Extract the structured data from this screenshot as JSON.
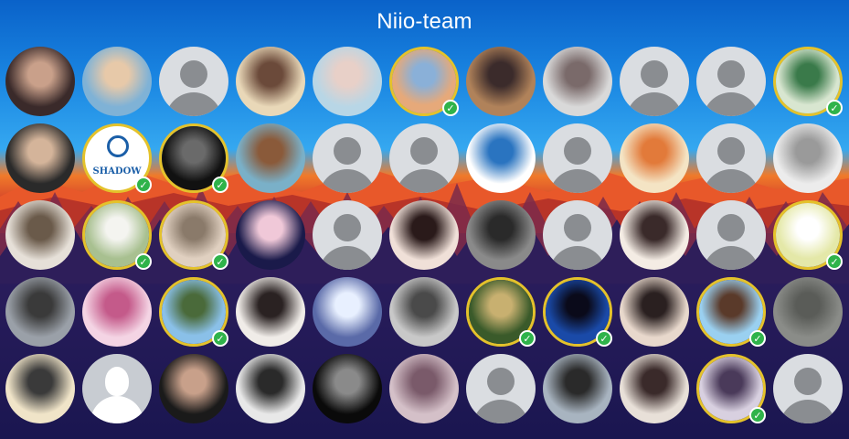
{
  "title": "Niio-team",
  "colors": {
    "badge": "#2fb34a",
    "ring": "#e4c22b",
    "placeholder_bg": "#dadde1",
    "placeholder_fg": "#8a8d91"
  },
  "avatars": [
    {
      "kind": "photo",
      "tone": [
        "#3a2a2a",
        "#c9a08a"
      ],
      "gold": false,
      "badge": false
    },
    {
      "kind": "photo",
      "tone": [
        "#7fb2d6",
        "#e7c9a9"
      ],
      "gold": false,
      "badge": false
    },
    {
      "kind": "default",
      "gold": false,
      "badge": false
    },
    {
      "kind": "photo",
      "tone": [
        "#e9d8b8",
        "#6b4a3a"
      ],
      "gold": false,
      "badge": false
    },
    {
      "kind": "photo",
      "tone": [
        "#b8d6e6",
        "#e8d0c8"
      ],
      "gold": false,
      "badge": false
    },
    {
      "kind": "photo",
      "tone": [
        "#e6a97a",
        "#8ab0d8"
      ],
      "gold": true,
      "badge": true
    },
    {
      "kind": "photo",
      "tone": [
        "#b0825a",
        "#3b2b2b"
      ],
      "gold": false,
      "badge": false
    },
    {
      "kind": "photo",
      "tone": [
        "#d9d9d9",
        "#7a6a6a"
      ],
      "gold": false,
      "badge": false
    },
    {
      "kind": "default",
      "gold": false,
      "badge": false
    },
    {
      "kind": "default",
      "gold": false,
      "badge": false
    },
    {
      "kind": "photo",
      "tone": [
        "#d8e6d0",
        "#3a7a4a"
      ],
      "gold": true,
      "badge": true
    },
    {
      "kind": "photo",
      "tone": [
        "#2a2a2a",
        "#d4b49a"
      ],
      "gold": false,
      "badge": false
    },
    {
      "kind": "logo",
      "text": "SHADOW",
      "gold": true,
      "badge": true
    },
    {
      "kind": "photo",
      "tone": [
        "#111111",
        "#6a6a6a"
      ],
      "gold": true,
      "badge": true
    },
    {
      "kind": "photo",
      "tone": [
        "#7ab0c8",
        "#8a5a3a"
      ],
      "gold": false,
      "badge": false
    },
    {
      "kind": "default",
      "gold": false,
      "badge": false
    },
    {
      "kind": "default",
      "gold": false,
      "badge": false
    },
    {
      "kind": "photo",
      "tone": [
        "#ffffff",
        "#2a74c0"
      ],
      "gold": false,
      "badge": false
    },
    {
      "kind": "default",
      "gold": false,
      "badge": false
    },
    {
      "kind": "photo",
      "tone": [
        "#f4e4c4",
        "#e27a3a"
      ],
      "gold": false,
      "badge": false
    },
    {
      "kind": "default",
      "gold": false,
      "badge": false
    },
    {
      "kind": "photo",
      "tone": [
        "#ececec",
        "#9a9a9a"
      ],
      "gold": false,
      "badge": false
    },
    {
      "kind": "photo",
      "tone": [
        "#e6e0d8",
        "#6a5a4a"
      ],
      "gold": false,
      "badge": false
    },
    {
      "kind": "photo",
      "tone": [
        "#a8c090",
        "#f4f4f0"
      ],
      "gold": true,
      "badge": true
    },
    {
      "kind": "photo",
      "tone": [
        "#e0d0c0",
        "#8a7a6a"
      ],
      "gold": true,
      "badge": true
    },
    {
      "kind": "photo",
      "tone": [
        "#1a1a4a",
        "#f0c8d8"
      ],
      "gold": false,
      "badge": false
    },
    {
      "kind": "default",
      "gold": false,
      "badge": false
    },
    {
      "kind": "photo",
      "tone": [
        "#f0e0d8",
        "#2a1a1a"
      ],
      "gold": false,
      "badge": false
    },
    {
      "kind": "photo",
      "tone": [
        "#8a8a8a",
        "#2a2a2a"
      ],
      "gold": false,
      "badge": false
    },
    {
      "kind": "default",
      "gold": false,
      "badge": false
    },
    {
      "kind": "photo",
      "tone": [
        "#f4ece4",
        "#3a2a2a"
      ],
      "gold": false,
      "badge": false
    },
    {
      "kind": "default",
      "gold": false,
      "badge": false
    },
    {
      "kind": "photo",
      "tone": [
        "#e4e8a8",
        "#ffffff"
      ],
      "gold": true,
      "badge": true
    },
    {
      "kind": "photo",
      "tone": [
        "#9aa0a8",
        "#3a3a3a"
      ],
      "gold": false,
      "badge": false
    },
    {
      "kind": "photo",
      "tone": [
        "#f4d4e4",
        "#c45a8a"
      ],
      "gold": false,
      "badge": false
    },
    {
      "kind": "photo",
      "tone": [
        "#8ac0e8",
        "#4a6a3a"
      ],
      "gold": true,
      "badge": true
    },
    {
      "kind": "photo",
      "tone": [
        "#f0ece8",
        "#2a2222"
      ],
      "gold": false,
      "badge": false
    },
    {
      "kind": "photo",
      "tone": [
        "#5a6aa8",
        "#e8f0ff"
      ],
      "gold": false,
      "badge": false
    },
    {
      "kind": "photo",
      "tone": [
        "#c8c8c8",
        "#4a4a4a"
      ],
      "gold": false,
      "badge": false
    },
    {
      "kind": "photo",
      "tone": [
        "#3a5a2a",
        "#c8b070"
      ],
      "gold": true,
      "badge": true
    },
    {
      "kind": "photo",
      "tone": [
        "#1a4aa8",
        "#0a0a1a"
      ],
      "gold": true,
      "badge": true
    },
    {
      "kind": "photo",
      "tone": [
        "#e8d8cc",
        "#2a2020"
      ],
      "gold": false,
      "badge": false
    },
    {
      "kind": "photo",
      "tone": [
        "#9ad0f0",
        "#5a3a2a"
      ],
      "gold": true,
      "badge": true
    },
    {
      "kind": "photo",
      "tone": [
        "#8a8c88",
        "#5a5c58"
      ],
      "gold": false,
      "badge": false
    },
    {
      "kind": "photo",
      "tone": [
        "#f0e4c8",
        "#3a3a3a"
      ],
      "gold": false,
      "badge": false
    },
    {
      "kind": "silhouette",
      "gold": false,
      "badge": false
    },
    {
      "kind": "photo",
      "tone": [
        "#1a1a1a",
        "#c8a08a"
      ],
      "gold": false,
      "badge": false
    },
    {
      "kind": "photo",
      "tone": [
        "#e8e8e8",
        "#2a2a2a"
      ],
      "gold": false,
      "badge": false
    },
    {
      "kind": "photo",
      "tone": [
        "#0a0a0a",
        "#8a8a8a"
      ],
      "gold": false,
      "badge": false
    },
    {
      "kind": "photo",
      "tone": [
        "#d4c0c8",
        "#7a5a6a"
      ],
      "gold": false,
      "badge": false
    },
    {
      "kind": "default",
      "gold": false,
      "badge": false
    },
    {
      "kind": "photo",
      "tone": [
        "#a8b4c0",
        "#2a2a2a"
      ],
      "gold": false,
      "badge": false
    },
    {
      "kind": "photo",
      "tone": [
        "#e8e0d8",
        "#3a2a2a"
      ],
      "gold": false,
      "badge": false
    },
    {
      "kind": "photo",
      "tone": [
        "#d8d0e0",
        "#4a3a5a"
      ],
      "gold": true,
      "badge": true
    },
    {
      "kind": "default",
      "gold": false,
      "badge": false
    }
  ]
}
